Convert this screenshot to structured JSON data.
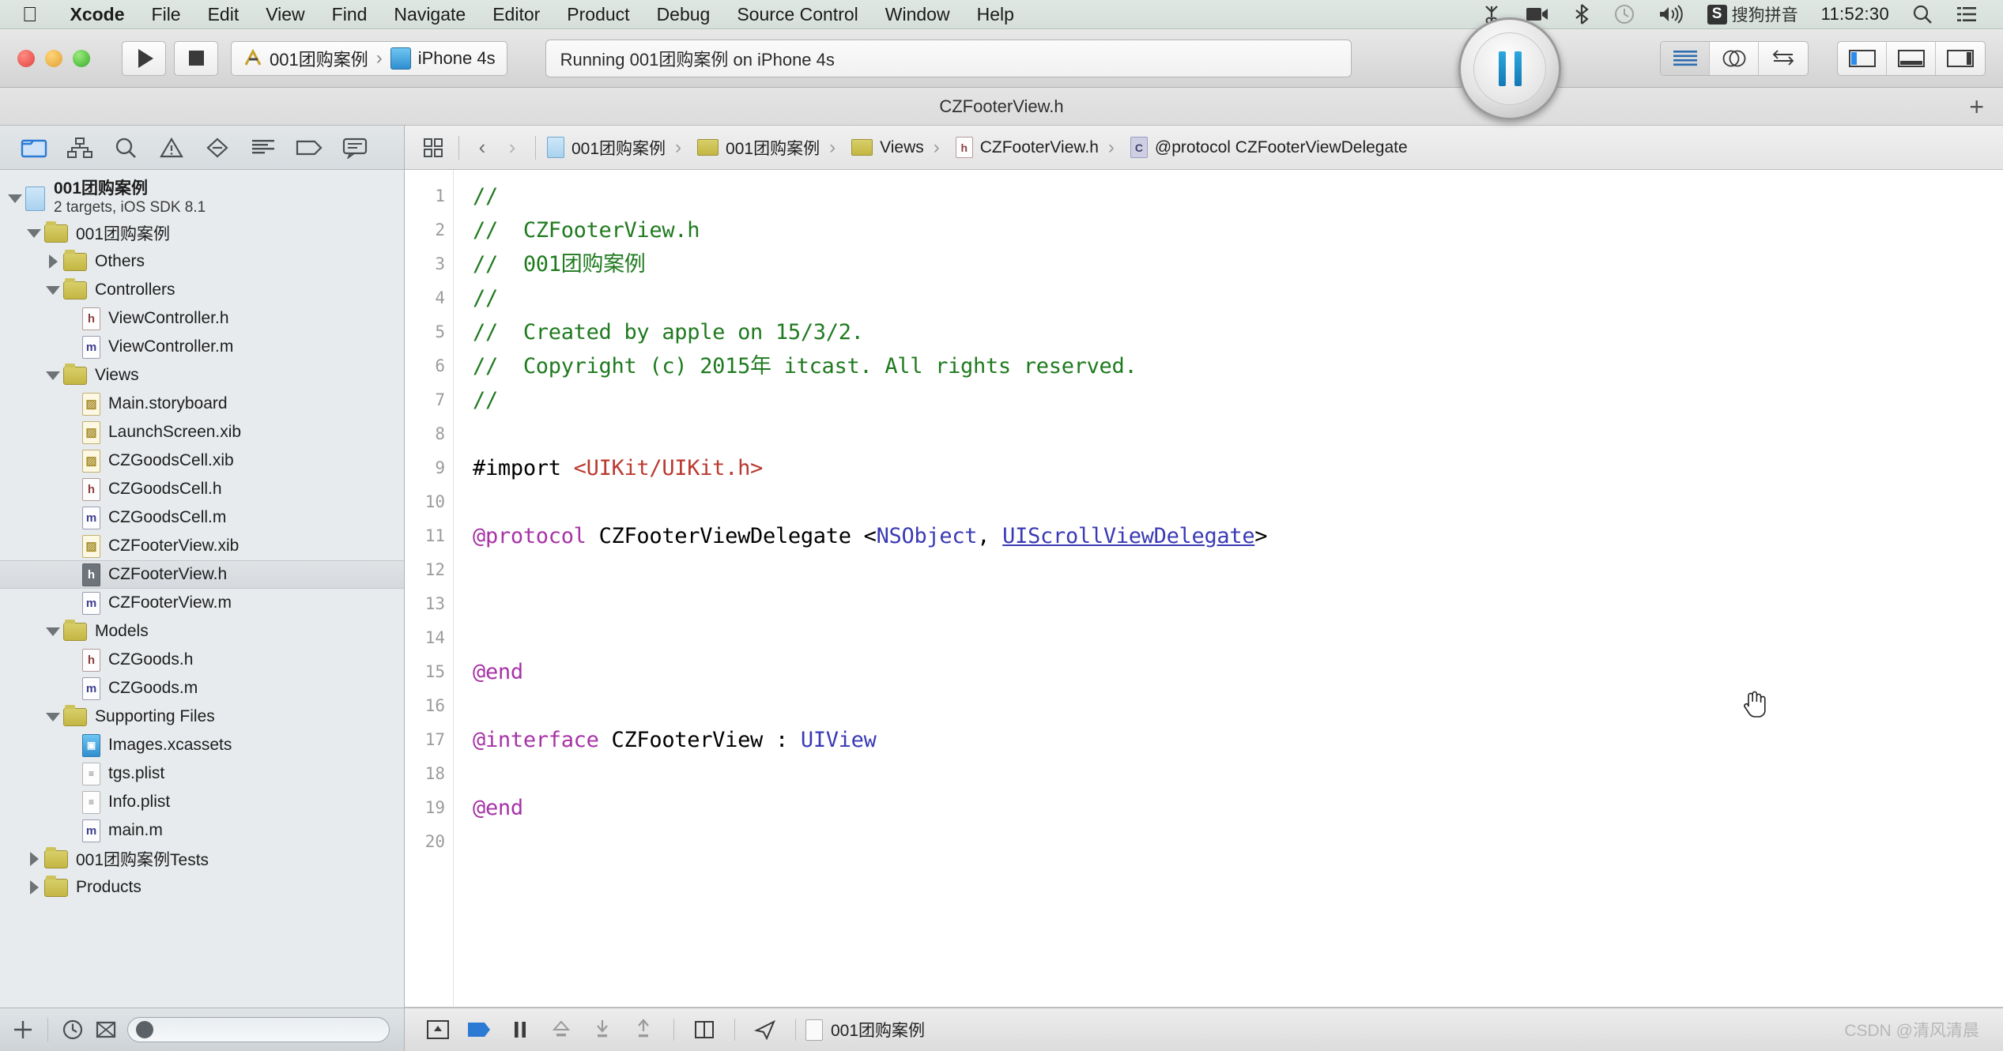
{
  "menubar": {
    "apple_icon": "apple-logo-icon",
    "items": [
      {
        "label": "Xcode",
        "bold": true
      },
      {
        "label": "File",
        "bold": false
      },
      {
        "label": "Edit",
        "bold": false
      },
      {
        "label": "View",
        "bold": false
      },
      {
        "label": "Find",
        "bold": false
      },
      {
        "label": "Navigate",
        "bold": false
      },
      {
        "label": "Editor",
        "bold": false
      },
      {
        "label": "Product",
        "bold": false
      },
      {
        "label": "Debug",
        "bold": false
      },
      {
        "label": "Source Control",
        "bold": false
      },
      {
        "label": "Window",
        "bold": false
      },
      {
        "label": "Help",
        "bold": false
      }
    ],
    "status": {
      "icons": [
        "scissors-icon",
        "video-camera-icon",
        "bluetooth-icon",
        "time-machine-icon",
        "volume-icon"
      ],
      "input_badge": "S",
      "input_method": "搜狗拼音",
      "clock": "11:52:30",
      "search_icon": "spotlight-search-icon",
      "menu_icon": "notification-center-icon"
    }
  },
  "toolbar": {
    "run_icon": "play-icon",
    "stop_icon": "stop-icon",
    "scheme": {
      "project": "001团购案例",
      "separator": "›",
      "destination": "iPhone 4s",
      "project_icon": "xcode-scheme-icon",
      "device_icon": "iphone-simulator-icon"
    },
    "activity": "Running 001团购案例 on iPhone 4s",
    "editor_modes": [
      {
        "name": "standard-editor",
        "active": true
      },
      {
        "name": "assistant-editor",
        "active": false
      },
      {
        "name": "version-editor",
        "active": false
      }
    ],
    "view_toggles": [
      {
        "name": "toggle-navigator",
        "active": true
      },
      {
        "name": "toggle-debug-area",
        "active": false
      },
      {
        "name": "toggle-utilities",
        "active": false
      }
    ],
    "overlay_pause_button": "screen-recording-pause-button"
  },
  "tabbar": {
    "title": "CZFooterView.h",
    "add_tab": "+"
  },
  "navigator": {
    "tabs": [
      {
        "name": "project-navigator",
        "active": true
      },
      {
        "name": "symbol-navigator",
        "active": false
      },
      {
        "name": "find-navigator",
        "active": false
      },
      {
        "name": "issue-navigator",
        "active": false
      },
      {
        "name": "test-navigator",
        "active": false
      },
      {
        "name": "debug-navigator",
        "active": false
      },
      {
        "name": "breakpoint-navigator",
        "active": false
      },
      {
        "name": "report-navigator",
        "active": false
      }
    ],
    "tree": [
      {
        "label": "001团购案例",
        "sublabel": "2 targets, iOS SDK 8.1",
        "type": "project",
        "depth": 0,
        "twisty": "down",
        "selected": false
      },
      {
        "label": "001团购案例",
        "type": "folder",
        "depth": 1,
        "twisty": "down",
        "selected": false
      },
      {
        "label": "Others",
        "type": "folder",
        "depth": 2,
        "twisty": "right",
        "selected": false
      },
      {
        "label": "Controllers",
        "type": "folder",
        "depth": 2,
        "twisty": "down",
        "selected": false
      },
      {
        "label": "ViewController.h",
        "type": "h",
        "depth": 3,
        "twisty": "",
        "selected": false
      },
      {
        "label": "ViewController.m",
        "type": "m",
        "depth": 3,
        "twisty": "",
        "selected": false
      },
      {
        "label": "Views",
        "type": "folder",
        "depth": 2,
        "twisty": "down",
        "selected": false
      },
      {
        "label": "Main.storyboard",
        "type": "xib",
        "depth": 3,
        "twisty": "",
        "selected": false
      },
      {
        "label": "LaunchScreen.xib",
        "type": "xib",
        "depth": 3,
        "twisty": "",
        "selected": false
      },
      {
        "label": "CZGoodsCell.xib",
        "type": "xib",
        "depth": 3,
        "twisty": "",
        "selected": false
      },
      {
        "label": "CZGoodsCell.h",
        "type": "h",
        "depth": 3,
        "twisty": "",
        "selected": false
      },
      {
        "label": "CZGoodsCell.m",
        "type": "m",
        "depth": 3,
        "twisty": "",
        "selected": false
      },
      {
        "label": "CZFooterView.xib",
        "type": "xib",
        "depth": 3,
        "twisty": "",
        "selected": false
      },
      {
        "label": "CZFooterView.h",
        "type": "h",
        "depth": 3,
        "twisty": "",
        "selected": true
      },
      {
        "label": "CZFooterView.m",
        "type": "m",
        "depth": 3,
        "twisty": "",
        "selected": false
      },
      {
        "label": "Models",
        "type": "folder",
        "depth": 2,
        "twisty": "down",
        "selected": false
      },
      {
        "label": "CZGoods.h",
        "type": "h",
        "depth": 3,
        "twisty": "",
        "selected": false
      },
      {
        "label": "CZGoods.m",
        "type": "m",
        "depth": 3,
        "twisty": "",
        "selected": false
      },
      {
        "label": "Supporting Files",
        "type": "folder",
        "depth": 2,
        "twisty": "down",
        "selected": false
      },
      {
        "label": "Images.xcassets",
        "type": "assets",
        "depth": 3,
        "twisty": "",
        "selected": false
      },
      {
        "label": "tgs.plist",
        "type": "plist",
        "depth": 3,
        "twisty": "",
        "selected": false
      },
      {
        "label": "Info.plist",
        "type": "plist",
        "depth": 3,
        "twisty": "",
        "selected": false
      },
      {
        "label": "main.m",
        "type": "m",
        "depth": 3,
        "twisty": "",
        "selected": false
      },
      {
        "label": "001团购案例Tests",
        "type": "folder",
        "depth": 1,
        "twisty": "right",
        "selected": false
      },
      {
        "label": "Products",
        "type": "folder",
        "depth": 1,
        "twisty": "right",
        "selected": false
      }
    ],
    "footer": {
      "add_icon": "plus-icon",
      "recent_icon": "clock-recent-icon",
      "filter_icon": "filter-source-icon",
      "filter_placeholder": "",
      "filter_value": ""
    }
  },
  "jumpbar": {
    "related_items_icon": "related-items-icon",
    "back_arrow": "‹",
    "forward_arrow": "›",
    "crumbs": [
      {
        "label": "001团购案例",
        "icon": "project-icon"
      },
      {
        "label": "001团购案例",
        "icon": "folder-icon"
      },
      {
        "label": "Views",
        "icon": "folder-icon"
      },
      {
        "label": "CZFooterView.h",
        "icon": "header-file-icon"
      },
      {
        "label": "@protocol CZFooterViewDelegate",
        "icon": "protocol-icon"
      }
    ],
    "separator": "›"
  },
  "code": {
    "filename": "CZFooterView.h",
    "line_numbers": [
      "1",
      "2",
      "3",
      "4",
      "5",
      "6",
      "7",
      "8",
      "9",
      "10",
      "11",
      "12",
      "13",
      "14",
      "15",
      "16",
      "17",
      "18",
      "19",
      "20"
    ],
    "lines": [
      {
        "n": 1,
        "tokens": [
          {
            "t": "//",
            "c": "cmt"
          }
        ]
      },
      {
        "n": 2,
        "tokens": [
          {
            "t": "//  CZFooterView.h",
            "c": "cmt"
          }
        ]
      },
      {
        "n": 3,
        "tokens": [
          {
            "t": "//  001团购案例",
            "c": "cmt"
          }
        ]
      },
      {
        "n": 4,
        "tokens": [
          {
            "t": "//",
            "c": "cmt"
          }
        ]
      },
      {
        "n": 5,
        "tokens": [
          {
            "t": "//  Created by apple on 15/3/2.",
            "c": "cmt"
          }
        ]
      },
      {
        "n": 6,
        "tokens": [
          {
            "t": "//  Copyright (c) 2015年 itcast. All rights reserved.",
            "c": "cmt"
          }
        ]
      },
      {
        "n": 7,
        "tokens": [
          {
            "t": "//",
            "c": "cmt"
          }
        ]
      },
      {
        "n": 8,
        "tokens": []
      },
      {
        "n": 9,
        "tokens": [
          {
            "t": "#import ",
            "c": "pln"
          },
          {
            "t": "<UIKit/UIKit.h>",
            "c": "str"
          }
        ]
      },
      {
        "n": 10,
        "tokens": []
      },
      {
        "n": 11,
        "tokens": [
          {
            "t": "@protocol",
            "c": "kw"
          },
          {
            "t": " CZFooterViewDelegate <",
            "c": "pln"
          },
          {
            "t": "NSObject",
            "c": "typ"
          },
          {
            "t": ", ",
            "c": "pln"
          },
          {
            "t": "UIScrollViewDelegate",
            "c": "link"
          },
          {
            "t": ">",
            "c": "pln"
          }
        ]
      },
      {
        "n": 12,
        "tokens": []
      },
      {
        "n": 13,
        "tokens": []
      },
      {
        "n": 14,
        "tokens": []
      },
      {
        "n": 15,
        "tokens": [
          {
            "t": "@end",
            "c": "kw"
          }
        ]
      },
      {
        "n": 16,
        "tokens": []
      },
      {
        "n": 17,
        "tokens": [
          {
            "t": "@interface",
            "c": "kw"
          },
          {
            "t": " CZFooterView : ",
            "c": "pln"
          },
          {
            "t": "UIView",
            "c": "typ"
          }
        ]
      },
      {
        "n": 18,
        "tokens": []
      },
      {
        "n": 19,
        "tokens": [
          {
            "t": "@end",
            "c": "kw"
          }
        ]
      },
      {
        "n": 20,
        "tokens": []
      }
    ],
    "colors": {
      "comment": "#1f7a1f",
      "keyword": "#a633a6",
      "string": "#bb3a30",
      "type": "#3a3ab5",
      "plain": "#000000"
    },
    "cursor": "hand-pointer-cursor"
  },
  "debugbar": {
    "icons": [
      {
        "name": "hide-debug-area-icon"
      },
      {
        "name": "continue-program-icon"
      },
      {
        "name": "pause-program-icon"
      },
      {
        "name": "step-over-icon"
      },
      {
        "name": "step-into-icon"
      },
      {
        "name": "step-out-icon"
      },
      {
        "name": "view-debugging-icon"
      },
      {
        "name": "simulate-location-icon"
      }
    ],
    "process_label": "001团购案例",
    "process_icon": "process-icon"
  },
  "watermark": "CSDN @清风清晨"
}
